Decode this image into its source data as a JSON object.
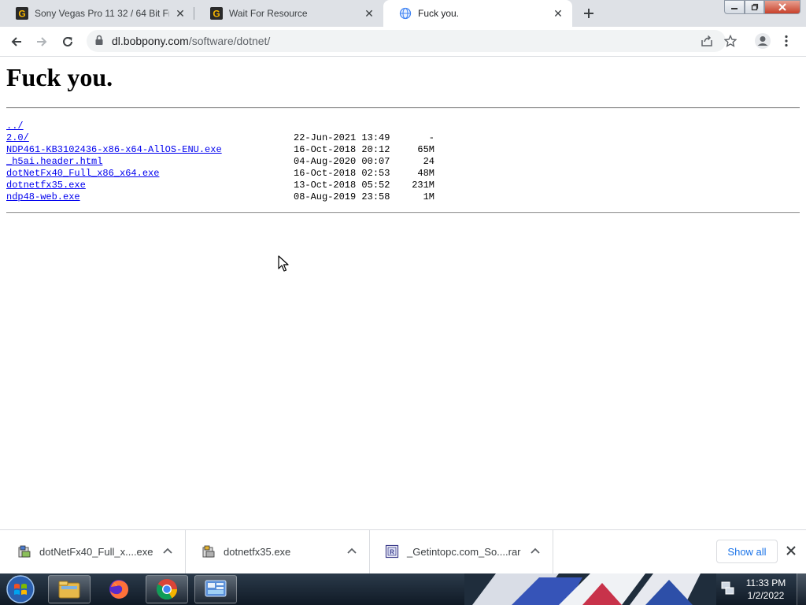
{
  "browser": {
    "tabs": [
      {
        "title": "Sony Vegas Pro 11 32 / 64 Bit Fre",
        "favicon": "getintopc-g-icon",
        "active": false
      },
      {
        "title": "Wait For Resource",
        "favicon": "getintopc-g-icon",
        "active": false
      },
      {
        "title": "Fuck you.",
        "favicon": "globe-icon",
        "active": true
      }
    ],
    "address": {
      "host": "dl.bobpony.com",
      "path": "/software/dotnet/"
    }
  },
  "page": {
    "title": "Fuck you.",
    "entries": [
      {
        "name": "../",
        "date": "",
        "size": ""
      },
      {
        "name": "2.0/",
        "date": "22-Jun-2021 13:49",
        "size": "-"
      },
      {
        "name": "NDP461-KB3102436-x86-x64-AllOS-ENU.exe",
        "date": "16-Oct-2018 20:12",
        "size": "65M"
      },
      {
        "name": "_h5ai.header.html",
        "date": "04-Aug-2020 00:07",
        "size": "24"
      },
      {
        "name": "dotNetFx40_Full_x86_x64.exe",
        "date": "16-Oct-2018 02:53",
        "size": "48M"
      },
      {
        "name": "dotnetfx35.exe",
        "date": "13-Oct-2018 05:52",
        "size": "231M"
      },
      {
        "name": "ndp48-web.exe",
        "date": "08-Aug-2019 23:58",
        "size": "1M"
      }
    ]
  },
  "downloads": {
    "items": [
      {
        "name": "dotNetFx40_Full_x....exe",
        "icon": "installer-icon"
      },
      {
        "name": "dotnetfx35.exe",
        "icon": "installer-icon"
      },
      {
        "name": "_Getintopc.com_So....rar",
        "icon": "rar-archive-icon"
      }
    ],
    "show_all_label": "Show all"
  },
  "taskbar": {
    "time": "11:33 PM",
    "date": "1/2/2022",
    "apps": [
      "file-explorer-icon",
      "firefox-icon",
      "chrome-icon",
      "control-panel-icon"
    ]
  },
  "colors": {
    "link": "#0000ee",
    "accent": "#1a73e8",
    "tabstrip": "#dee1e6"
  }
}
